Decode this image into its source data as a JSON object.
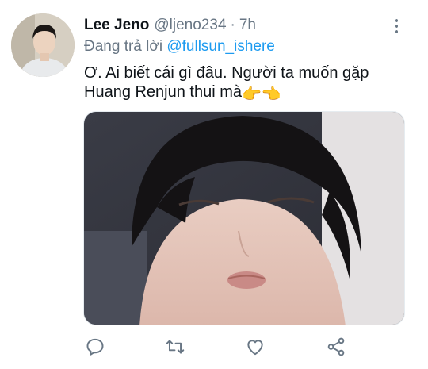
{
  "tweet": {
    "author_name": "Lee Jeno",
    "author_handle": "@ljeno234",
    "separator": "·",
    "time": "7h",
    "reply_prefix": "Đang trả lời",
    "reply_mention": "@fullsun_ishere",
    "text": "Ơ. Ai biết cái gì đâu. Người ta muốn gặp Huang Renjun thui mà",
    "emoji": "👉👈"
  },
  "icons": {
    "more": "more-vertical-icon",
    "reply": "reply-icon",
    "retweet": "retweet-icon",
    "like": "heart-icon",
    "share": "share-icon"
  },
  "colors": {
    "text_primary": "#0f1419",
    "text_secondary": "#687684",
    "mention": "#1d9bf0",
    "divider": "#e6ecf0"
  }
}
